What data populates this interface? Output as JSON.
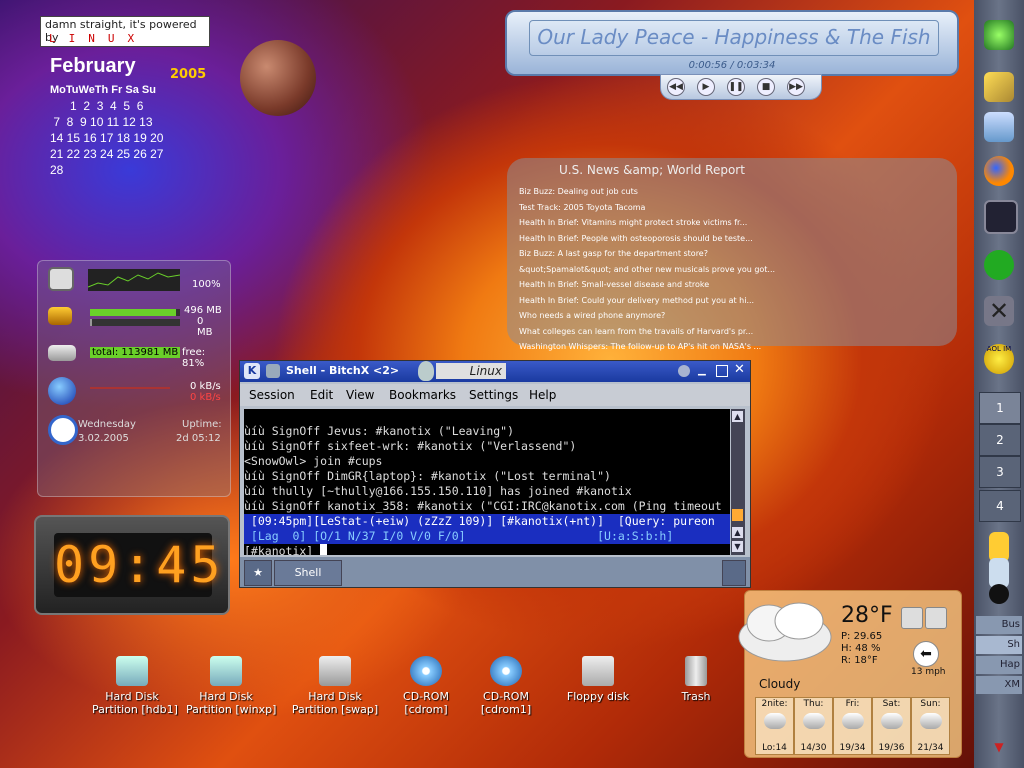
{
  "logo": {
    "line1": "damn straight, it's powered by",
    "line2": "LINUX"
  },
  "calendar": {
    "month": "February",
    "year": "2005",
    "day_header": "MoTuWeTh Fr Sa Su",
    "rows": [
      "      1  2  3  4  5  6",
      " 7  8  9 10 11 12 13",
      "14 15 16 17 18 19 20",
      "21 22 23 24 25 26 27",
      "28"
    ]
  },
  "sysmon": {
    "cpu": "100%",
    "mem_used": "496 MB",
    "swap_used": "0 MB",
    "disk_total": "total: 113981 MB",
    "disk_free": "free: 81%",
    "net_in": "0 kB/s",
    "net_out": "0 kB/s",
    "day": "Wednesday",
    "date": "3.02.2005",
    "uptime_label": "Uptime:",
    "uptime": "2d 05:12"
  },
  "clock": {
    "time": "09:45"
  },
  "player": {
    "track": "Our Lady Peace - Happiness & The Fish",
    "time": "0:00:56 / 0:03:34"
  },
  "news": {
    "source": "U.S. News &amp; World Report",
    "items": [
      "Biz Buzz: Dealing out job cuts",
      "Test Track: 2005 Toyota Tacoma",
      "Health In Brief: Vitamins might protect stroke victims fr...",
      "Health In Brief: People with osteoporosis should be teste...",
      "Biz Buzz: A last gasp for the department store?",
      "&quot;Spamalot&quot; and other new musicals prove you got...",
      "Health In Brief: Small-vessel disease and stroke",
      "Health In Brief: Could your delivery method put you at hi...",
      "Who needs a wired phone anymore?",
      "What colleges can learn from the travails of Harvard's pr...",
      "Washington Whispers: The follow-up to AP's hit on NASA's ..."
    ]
  },
  "shell": {
    "title": "Shell - BitchX <2>",
    "brand": "Linux",
    "menu": [
      "Session",
      "Edit",
      "View",
      "Bookmarks",
      "Settings",
      "Help"
    ],
    "lines": [
      {
        "t": "ùíù SignOff Jevus: #kanotix (\"Leaving\")"
      },
      {
        "t": "ùíù SignOff sixfeet-wrk: #kanotix (\"Verlassend\")"
      },
      {
        "t": "<SnowOwl> join #cups"
      },
      {
        "t": "ùíù SignOff DimGR{laptop}: #kanotix (\"Lost terminal\")"
      },
      {
        "t": "ùíù thully [~thully@166.155.150.110] has joined #kanotix"
      },
      {
        "t": "ùíù SignOff kanotix_358: #kanotix (\"CGI:IRC@kanotix.com (Ping timeout"
      }
    ],
    "status1": " [09:45pm][LeStat-(+eiw) (zZzZ 109)] [#kanotix(+nt)]  [Query: pureon",
    "status2": " [Lag  0] [O/1 N/37 I/0 V/0 F/0]                   [U:a:S:b:h]",
    "prompt": "[#kanotix] ",
    "tab_label": "Shell"
  },
  "weather": {
    "temp": "28°F",
    "pressure": "P: 29.65",
    "humidity": "H: 48 %",
    "realfeel": "R: 18°F",
    "wind": "13 mph",
    "condition": "Cloudy",
    "forecast": [
      {
        "day": "2nite:",
        "range": "Lo:14"
      },
      {
        "day": "Thu:",
        "range": "14/30"
      },
      {
        "day": "Fri:",
        "range": "19/34"
      },
      {
        "day": "Sat:",
        "range": "19/36"
      },
      {
        "day": "Sun:",
        "range": "21/34"
      }
    ]
  },
  "rpanel": {
    "pager": [
      "1",
      "2",
      "3",
      "4"
    ],
    "aol": "AOL IM",
    "tasks": [
      "Bus",
      "Sh",
      "Hap",
      "XM"
    ]
  },
  "desktop_icons": [
    {
      "label": "Hard Disk\nPartition [hdb1]"
    },
    {
      "label": "Hard Disk\nPartition [winxp]"
    },
    {
      "label": "Hard Disk\nPartition [swap]"
    },
    {
      "label": "CD-ROM\n[cdrom]"
    },
    {
      "label": "CD-ROM\n[cdrom1]"
    },
    {
      "label": "Floppy disk"
    },
    {
      "label": "Trash"
    }
  ],
  "colors": {
    "accent": "#1a3aa0",
    "nixie": "#ffa020",
    "term_select": "#1a2ec0"
  }
}
